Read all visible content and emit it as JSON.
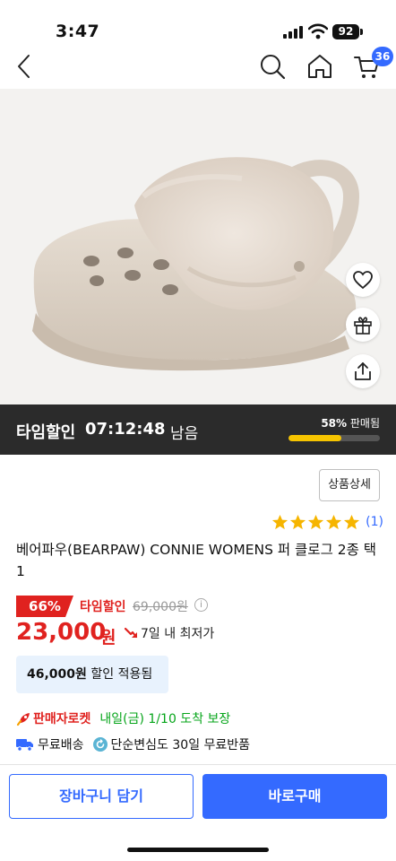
{
  "status_bar": {
    "time": "3:47",
    "battery": "92"
  },
  "nav": {
    "cart_count": "36",
    "icons": [
      "back-icon",
      "search-icon",
      "home-icon",
      "cart-icon"
    ]
  },
  "hero": {
    "side_icons": [
      "heart-icon",
      "gift-icon",
      "share-icon"
    ]
  },
  "timer": {
    "label": "타임할인",
    "clock": "07:12:48",
    "remaining": "남음",
    "sold_percent": "58%",
    "sold_label": "판매됨",
    "progress": 0.58
  },
  "detail_button": "상품상세",
  "rating": {
    "stars": 5,
    "count": "(1)"
  },
  "product": {
    "title": "베어파우(BEARPAW) CONNIE WOMENS 퍼 클로그 2종 택1",
    "discount": "66%",
    "time_sale": "타임할인",
    "original_price": "69,000원",
    "price": "23,000",
    "price_unit": "원",
    "lowest_note": "7일 내 최저가",
    "coupon_amount": "46,000원",
    "coupon_text": "할인 적용됨"
  },
  "delivery": {
    "rocket_name": "판매자로켓",
    "rocket_date": "내일(금) 1/10 도착 보장",
    "free_shipping": "무료배송",
    "returns": "단순변심도 30일 무료반품"
  },
  "buttons": {
    "cart": "장바구니 담기",
    "buy": "바로구매"
  },
  "colors": {
    "accent": "#346aff",
    "sale": "#e0221f",
    "rocket_date": "#06a51a",
    "progress": "#f6c400",
    "star": "#f6b500"
  }
}
